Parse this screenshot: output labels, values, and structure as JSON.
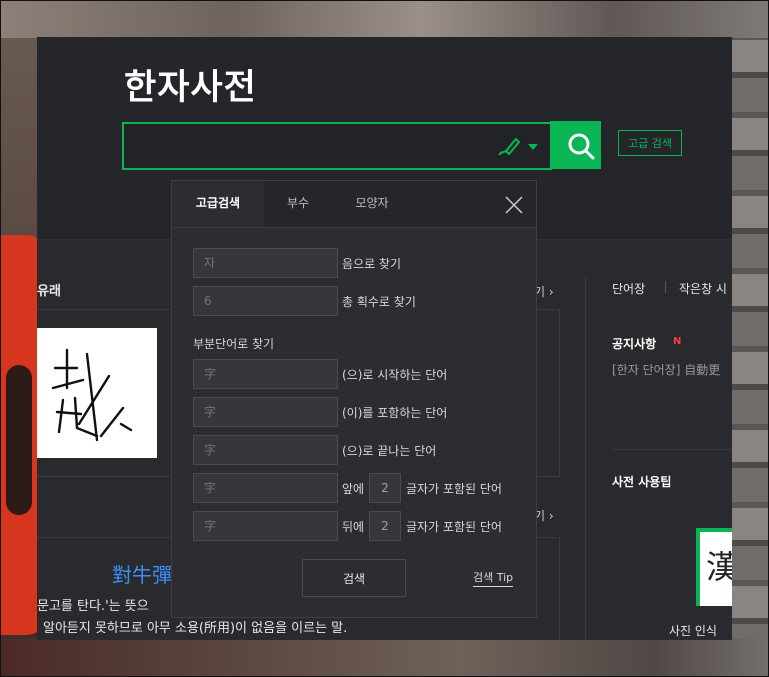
{
  "app": {
    "title": "한자사전"
  },
  "search": {
    "placeholder": "",
    "advanced_label": "고급 검색"
  },
  "popup": {
    "tabs": [
      {
        "label": "고급검색",
        "active": true
      },
      {
        "label": "부수",
        "active": false
      },
      {
        "label": "모양자",
        "active": false
      }
    ],
    "reading": {
      "placeholder": "자",
      "suffix": "음으로 찾기"
    },
    "strokes": {
      "placeholder": "6",
      "suffix": "총 획수로 찾기"
    },
    "partial_title": "부분단어로 찾기",
    "starts": {
      "placeholder": "字",
      "suffix": "(으)로 시작하는 단어"
    },
    "contains": {
      "placeholder": "字",
      "suffix": "(이)를 포함하는 단어"
    },
    "ends": {
      "placeholder": "字",
      "suffix": "(으)로 끝나는 단어"
    },
    "front": {
      "placeholder": "字",
      "prefix": "앞에",
      "count": "2",
      "suffix": "글자가 포함된 단어"
    },
    "back": {
      "placeholder": "字",
      "prefix": "뒤에",
      "count": "2",
      "suffix": "글자가 포함된 단어"
    },
    "submit_label": "검색",
    "tip_label": "검색 Tip"
  },
  "content": {
    "left_heading": "유래",
    "more_1": "기 ›",
    "more_2": "기 ›",
    "idiom_hanja": "對牛彈",
    "idiom_desc_1": "문고를 탄다.'는 뜻으",
    "idiom_desc_2": "알아듣지 못하므로 아무 소용(所用)이 없음을 이르는 말."
  },
  "sidebar": {
    "tab_1": "단어장",
    "tab_2": "작은창 시",
    "notice_heading": "공지사항",
    "notice_badge": "N",
    "notice_item": "[한자 단어장] 自動更",
    "tip_heading": "사전 사용팁",
    "photo_glyph": "漢",
    "photo_label": "사진 인식"
  },
  "colors": {
    "accent": "#09b555",
    "link": "#3e8ef7",
    "new_badge": "#ff3b3b"
  },
  "icons": {
    "handwrite": "handwriting-pen-icon",
    "search": "magnifier-icon",
    "close": "close-x-icon",
    "dropdown": "caret-down-icon"
  }
}
